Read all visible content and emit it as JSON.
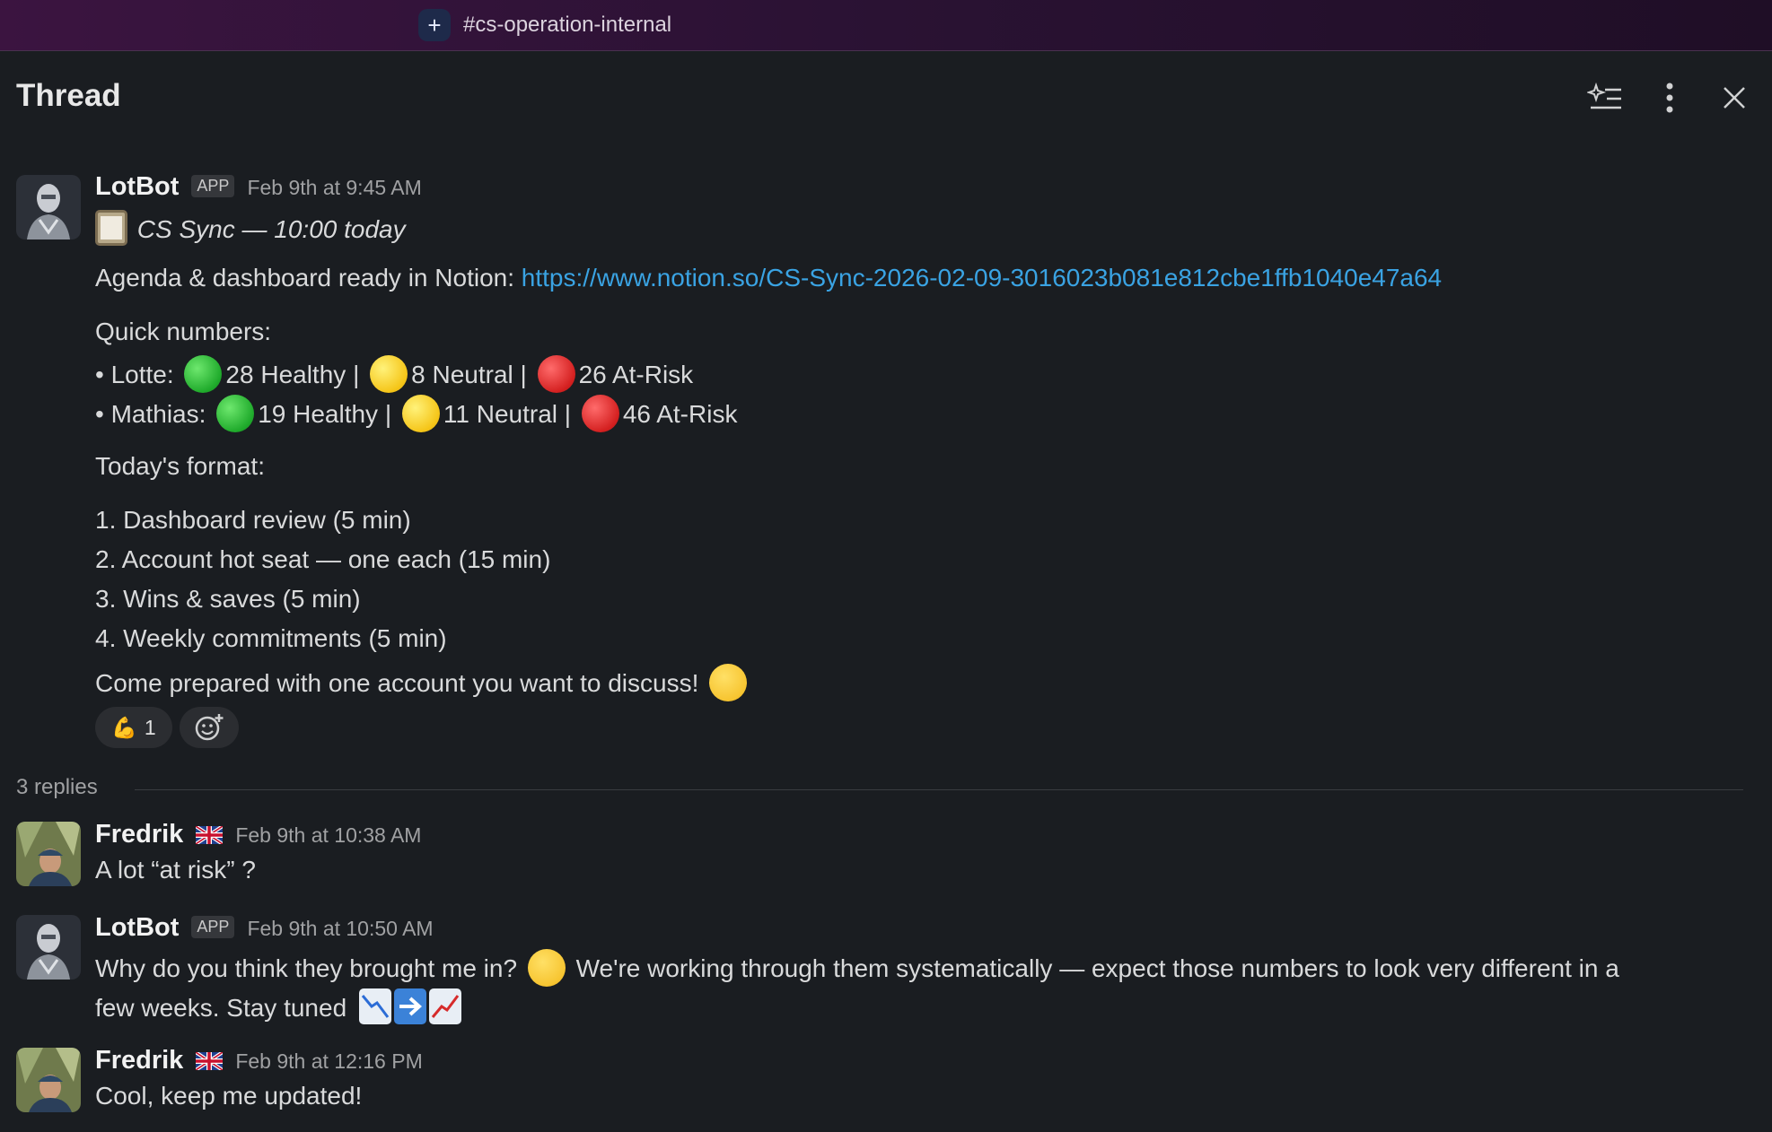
{
  "channel": {
    "name": "#cs-operation-internal"
  },
  "thread": {
    "title": "Thread",
    "actions": [
      "ai-summary-icon",
      "more-vertical-icon",
      "close-icon"
    ]
  },
  "parent_message": {
    "author": "LotBot",
    "badge": "APP",
    "timestamp": "Feb 9th at 9:45 AM",
    "heading": "CS Sync — 10:00 today",
    "agenda_prefix": "Agenda & dashboard ready in Notion: ",
    "agenda_link": "https://www.notion.so/CS-Sync-2026-02-09-3016023b081e812cbe1ffb1040e47a64",
    "quick_numbers_label": "Quick numbers:",
    "stats": [
      {
        "name": "• Lotte:",
        "healthy": "28 Healthy |",
        "neutral": "8 Neutral |",
        "at_risk": "26 At-Risk"
      },
      {
        "name": "• Mathias:",
        "healthy": "19 Healthy |",
        "neutral": "11 Neutral |",
        "at_risk": "46 At-Risk"
      }
    ],
    "format_label": "Today's format:",
    "format_items": [
      "1. Dashboard review (5 min)",
      "2. Account hot seat — one each (15 min)",
      "3. Wins & saves (5 min)",
      "4. Weekly commitments (5 min)"
    ],
    "closing": "Come prepared with one account you want to discuss!",
    "reactions": [
      {
        "emoji": "💪",
        "count": "1"
      }
    ]
  },
  "replies_label": "3 replies",
  "replies": [
    {
      "author": "Fredrik",
      "timestamp": "Feb 9th at 10:38 AM",
      "lines": [
        "A lot “at risk” ?"
      ]
    },
    {
      "author": "LotBot",
      "badge": "APP",
      "timestamp": "Feb 9th at 10:50 AM",
      "line1_a": "Why do you think they brought me in?",
      "line1_b": "We're working through them systematically — expect those numbers to look very different in a",
      "line2": "few weeks. Stay tuned"
    },
    {
      "author": "Fredrik",
      "timestamp": "Feb 9th at 12:16 PM",
      "lines": [
        "Cool, keep me updated!"
      ]
    }
  ],
  "colors": {
    "background": "#1a1d21",
    "link": "#3aa3e3",
    "topbar": "#3b1440"
  }
}
